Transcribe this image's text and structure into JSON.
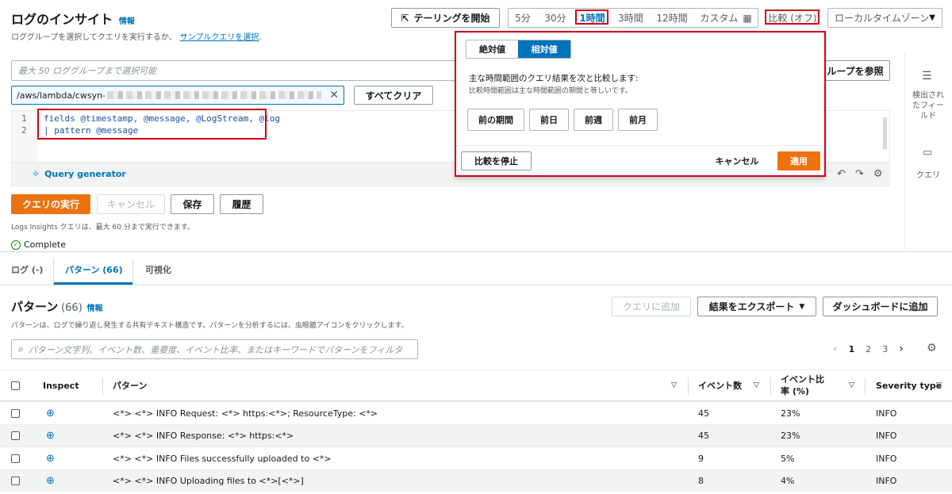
{
  "header": {
    "title": "ログのインサイト",
    "info": "情報",
    "subtitle": "ロググループを選択してクエリを実行するか、",
    "sample_link": "サンプルクエリを選択",
    "subtitle_end": "."
  },
  "toolbar": {
    "tail_button": "テーリングを開始",
    "ranges": [
      "5分",
      "30分",
      "1時間",
      "3時間",
      "12時間"
    ],
    "custom": "カスタム",
    "compare": "比較 (オフ)",
    "timezone": "ローカルタイムゾーン"
  },
  "loggroup": {
    "placeholder": "最大 50 ロググループまで選択可能",
    "selected": "/aws/lambda/cwsyn-",
    "clear_all": "すべてクリア",
    "browse": "ループを参照"
  },
  "editor": {
    "line_numbers": [
      "1",
      "2"
    ],
    "line1": "fields @timestamp, @message, @LogStream, @log",
    "line2": "| pattern @message",
    "query_generator": "Query generator"
  },
  "actions": {
    "run": "クエリの実行",
    "cancel": "キャンセル",
    "save": "保存",
    "history": "履歴",
    "note": "Logs Insights クエリは、最大 60 分まで実行できます。",
    "status": "Complete"
  },
  "side_panel": {
    "fields_label": "検出されたフィールド",
    "query_label": "クエリ"
  },
  "popover": {
    "tab_absolute": "絶対値",
    "tab_relative": "相対値",
    "heading": "主な時間範囲のクエリ結果を次と比較します:",
    "desc": "比較時間範囲は主な時間範囲の期間と等しいです。",
    "options": [
      "前の期間",
      "前日",
      "前週",
      "前月"
    ],
    "stop": "比較を停止",
    "cancel": "キャンセル",
    "apply": "適用"
  },
  "tabs": [
    "ログ (-)",
    "パターン (66)",
    "可視化"
  ],
  "patterns": {
    "title": "パターン",
    "count": "(66)",
    "info": "情報",
    "add_query": "クエリに追加",
    "export": "結果をエクスポート",
    "add_dashboard": "ダッシュボードに追加",
    "description": "パターンは、ログで繰り返し発生する共有テキスト構造です。パターンを分析するには、虫眼鏡アイコンをクリックします。",
    "filter_placeholder": "パターン文字列、イベント数、重要度、イベント比率、またはキーワードでパターンをフィルタ",
    "pages": [
      "1",
      "2",
      "3"
    ],
    "columns": {
      "inspect": "Inspect",
      "pattern": "パターン",
      "events": "イベント数",
      "ratio": "イベント比率 (%)",
      "severity": "Severity type"
    },
    "rows": [
      {
        "pattern": "<*> <*> INFO Request: <*> https:<*>; ResourceType: <*>",
        "events": "45",
        "ratio": "23%",
        "severity": "INFO"
      },
      {
        "pattern": "<*> <*> INFO Response: <*> https:<*>",
        "events": "45",
        "ratio": "23%",
        "severity": "INFO"
      },
      {
        "pattern": "<*> <*> INFO Files successfully uploaded to <*>",
        "events": "9",
        "ratio": "5%",
        "severity": "INFO"
      },
      {
        "pattern": "<*> <*> INFO Uploading files to <*>[<*>]",
        "events": "8",
        "ratio": "4%",
        "severity": "INFO"
      }
    ]
  },
  "colors": {
    "accent": "#ec7211",
    "link": "#0073bb",
    "highlight": "#d0021b",
    "success": "#1d8102"
  }
}
